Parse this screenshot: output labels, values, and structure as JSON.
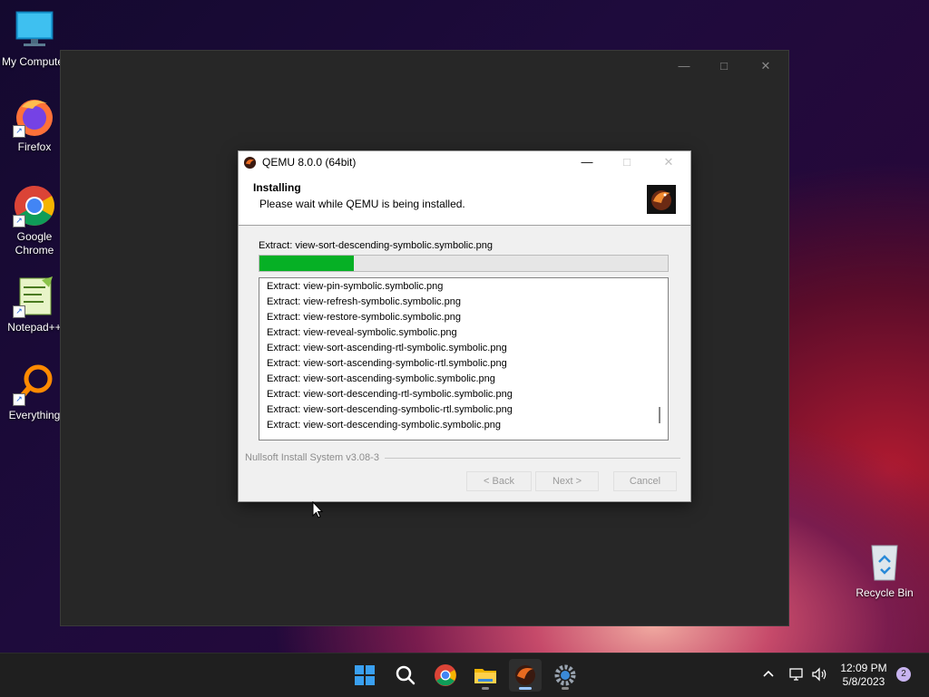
{
  "desktop_icons": [
    {
      "label": "My Computer",
      "icon": "monitor-icon"
    },
    {
      "label": "Firefox",
      "icon": "firefox-icon"
    },
    {
      "label": "Google Chrome",
      "icon": "chrome-icon"
    },
    {
      "label": "Notepad++",
      "icon": "notepadpp-icon"
    },
    {
      "label": "Everything",
      "icon": "everything-search-icon"
    },
    {
      "label": "Recycle Bin",
      "icon": "recycle-bin-icon"
    }
  ],
  "installer": {
    "title": "QEMU 8.0.0 (64bit)",
    "header_title": "Installing",
    "header_subtitle": "Please wait while QEMU is being installed.",
    "current_file": "Extract: view-sort-descending-symbolic.symbolic.png",
    "progress_fraction": 0.23,
    "progress_color": "#06b025",
    "log": [
      "Extract: view-pin-symbolic.symbolic.png",
      "Extract: view-refresh-symbolic.symbolic.png",
      "Extract: view-restore-symbolic.symbolic.png",
      "Extract: view-reveal-symbolic.symbolic.png",
      "Extract: view-sort-ascending-rtl-symbolic.symbolic.png",
      "Extract: view-sort-ascending-symbolic-rtl.symbolic.png",
      "Extract: view-sort-ascending-symbolic.symbolic.png",
      "Extract: view-sort-descending-rtl-symbolic.symbolic.png",
      "Extract: view-sort-descending-symbolic-rtl.symbolic.png",
      "Extract: view-sort-descending-symbolic.symbolic.png"
    ],
    "branding": "Nullsoft Install System v3.08-3",
    "buttons": {
      "back": "< Back",
      "next": "Next >",
      "cancel": "Cancel"
    }
  },
  "taskbar": {
    "apps": [
      "start-icon",
      "search-icon",
      "chrome-icon",
      "file-explorer-icon",
      "qemu-installer-icon",
      "settings-icon"
    ],
    "active_app": "qemu-installer-icon"
  },
  "tray": {
    "time": "12:09 PM",
    "date": "5/8/2023",
    "notification_count": "2"
  }
}
